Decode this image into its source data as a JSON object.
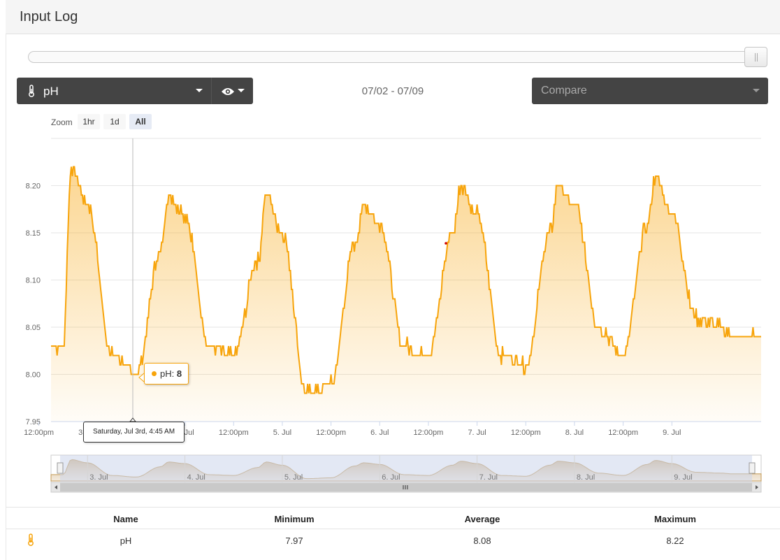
{
  "header": {
    "title": "Input Log"
  },
  "toolbar": {
    "input_label": "pH",
    "input_icon": "thermometer-icon",
    "view_icon": "eye-icon",
    "date_range": "07/02 - 07/09",
    "compare_placeholder": "Compare"
  },
  "zoom": {
    "label": "Zoom",
    "buttons": [
      "1hr",
      "1d",
      "All"
    ],
    "active": "All"
  },
  "tooltip": {
    "series_label": "pH: ",
    "value": "8",
    "time": "Saturday, Jul 3rd, 4:45 AM"
  },
  "colors": {
    "series": "#f7a40b",
    "toolbar_bg": "#444444",
    "navigator_mask": "#ccd6eb"
  },
  "chart_data": {
    "type": "area",
    "series": [
      {
        "name": "pH",
        "color": "#f7a40b"
      }
    ],
    "x": [
      "07/02 18:00",
      "07/03 00:00",
      "07/03 06:00",
      "07/03 12:00",
      "07/03 18:00",
      "07/04 00:00",
      "07/04 06:00",
      "07/04 12:00",
      "07/04 18:00",
      "07/05 00:00",
      "07/05 06:00",
      "07/05 12:00",
      "07/05 18:00",
      "07/06 00:00",
      "07/06 06:00",
      "07/06 12:00",
      "07/06 18:00",
      "07/07 00:00",
      "07/07 06:00",
      "07/07 12:00",
      "07/07 18:00",
      "07/08 00:00",
      "07/08 06:00",
      "07/08 12:00",
      "07/08 18:00",
      "07/09 00:00",
      "07/09 06:00",
      "07/09 12:00",
      "07/09 15:00"
    ],
    "values": [
      8.03,
      8.18,
      8.02,
      8.0,
      8.13,
      8.17,
      8.03,
      8.02,
      8.12,
      8.15,
      7.98,
      7.99,
      8.14,
      8.16,
      8.03,
      8.02,
      8.15,
      8.17,
      8.02,
      8.01,
      8.15,
      8.18,
      8.05,
      8.02,
      8.16,
      8.17,
      8.06,
      8.05,
      8.04
    ],
    "peaks": [
      {
        "x": "07/02 20:00",
        "y": 8.22
      },
      {
        "x": "07/03 20:00",
        "y": 8.19
      },
      {
        "x": "07/04 20:00",
        "y": 8.19
      },
      {
        "x": "07/05 20:00",
        "y": 8.18
      },
      {
        "x": "07/06 20:00",
        "y": 8.2
      },
      {
        "x": "07/07 20:00",
        "y": 8.2
      },
      {
        "x": "07/08 20:00",
        "y": 8.21
      }
    ],
    "yticks": [
      "7.95",
      "8.00",
      "8.05",
      "8.10",
      "8.15",
      "8.20"
    ],
    "ylim": [
      7.95,
      8.25
    ],
    "xticks": [
      "12:00pm",
      "3. Jul",
      "12:00pm",
      "4. Jul",
      "12:00pm",
      "5. Jul",
      "12:00pm",
      "6. Jul",
      "12:00pm",
      "7. Jul",
      "12:00pm",
      "8. Jul",
      "12:00pm",
      "9. Jul"
    ],
    "navigator_ticks": [
      "3. Jul",
      "4. Jul",
      "5. Jul",
      "6. Jul",
      "7. Jul",
      "8. Jul",
      "9. Jul"
    ],
    "grid": true,
    "legend": "none"
  },
  "stats": {
    "headers": [
      "Name",
      "Minimum",
      "Average",
      "Maximum"
    ],
    "rows": [
      {
        "icon": "thermometer-icon",
        "name": "pH",
        "min": "7.97",
        "avg": "8.08",
        "max": "8.22"
      }
    ]
  }
}
